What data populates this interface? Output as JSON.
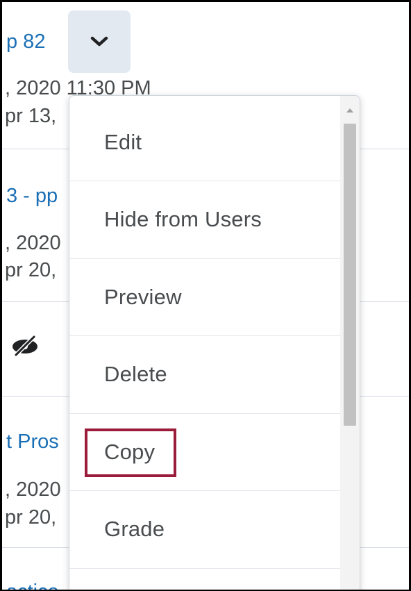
{
  "rows": [
    {
      "link": "p 82",
      "date1": ", 2020 11:30 PM",
      "date2": "pr 13,"
    },
    {
      "link": "3 - pp",
      "date1": ", 2020",
      "date2": "pr 20,"
    },
    {
      "link": "",
      "date1": "",
      "date2": ""
    },
    {
      "link": "t Pros",
      "date1": ", 2020",
      "date2": "pr 20,"
    },
    {
      "link": "actice",
      "date1": "",
      "date2": ""
    }
  ],
  "dropdown_toggle": {
    "icon": "chevron-down-icon"
  },
  "hidden_indicator": {
    "icon": "eye-slash-icon"
  },
  "menu": {
    "items": [
      {
        "label": "Edit"
      },
      {
        "label": "Hide from Users"
      },
      {
        "label": "Preview"
      },
      {
        "label": "Delete"
      },
      {
        "label": "Copy",
        "highlighted": true
      },
      {
        "label": "Grade"
      }
    ]
  },
  "colors": {
    "link": "#1a6fb5",
    "text": "#494c4e",
    "highlight": "#9b1c3a",
    "button_bg": "#e3e9f1"
  }
}
